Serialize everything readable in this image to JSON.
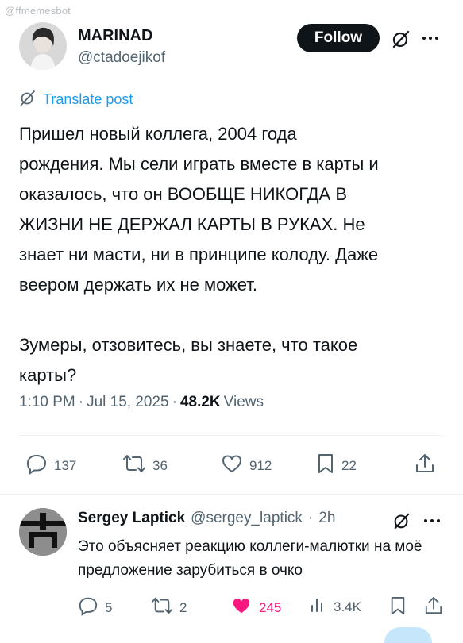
{
  "watermark": "@ffmemesbot",
  "post": {
    "author_name": "MARINAD",
    "author_handle": "@ctadoejikof",
    "follow_label": "Follow",
    "translate_label": "Translate post",
    "text": "Пришел новый коллега, 2004 года\nрождения. Мы сели играть вместе в карты и\nоказалось, что он ВООБЩЕ НИКОГДА В\nЖИЗНИ НЕ ДЕРЖАЛ КАРТЫ В РУКАХ. Не\nзнает ни масти, ни в принципе колоду. Даже\nвеером держать их не может.\n\nЗумеры, отзовитесь, вы знаете, что такое\nкарты?",
    "time": "1:10 PM",
    "date": "Jul 15, 2025",
    "views_count": "48.2K",
    "views_label": "Views",
    "separator": "·",
    "replies": "137",
    "reposts": "36",
    "likes": "912",
    "bookmarks": "22"
  },
  "reply": {
    "author_name": "Sergey Laptick",
    "author_handle": "@sergey_laptick",
    "separator": "·",
    "age": "2h",
    "text": "Это объясняет реакцию коллеги-малютки на моё предложение зарубиться в очко",
    "replies": "5",
    "reposts": "2",
    "likes": "245",
    "views": "3.4K"
  },
  "colors": {
    "accent": "#1d9bf0",
    "like": "#f91880",
    "text": "#0f1419",
    "secondary": "#536471"
  },
  "icons": [
    "more-icon",
    "grok-icon",
    "translate-icon",
    "reply-icon",
    "repost-icon",
    "like-icon",
    "bookmark-icon",
    "share-icon",
    "views-icon"
  ]
}
